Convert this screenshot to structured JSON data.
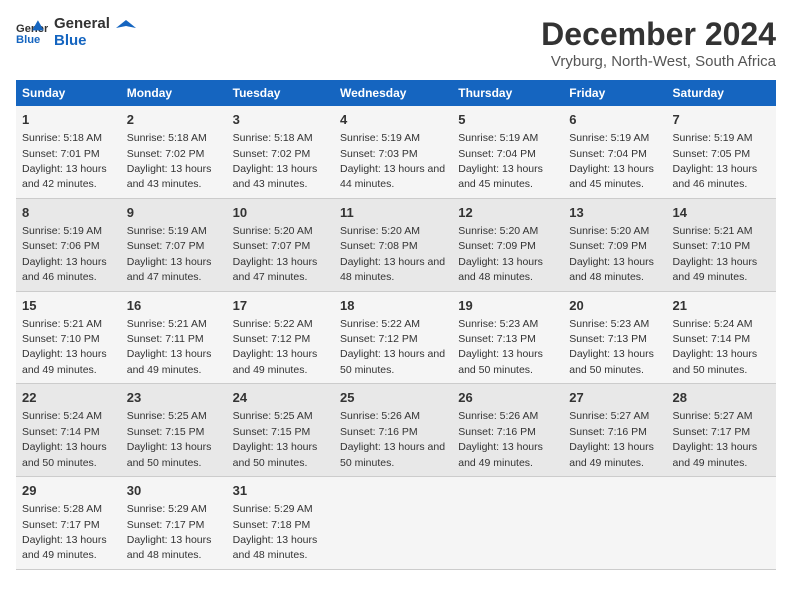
{
  "logo": {
    "line1": "General",
    "line2": "Blue"
  },
  "title": "December 2024",
  "subtitle": "Vryburg, North-West, South Africa",
  "columns": [
    "Sunday",
    "Monday",
    "Tuesday",
    "Wednesday",
    "Thursday",
    "Friday",
    "Saturday"
  ],
  "weeks": [
    [
      {
        "day": "1",
        "sunrise": "5:18 AM",
        "sunset": "7:01 PM",
        "daylight": "13 hours and 42 minutes."
      },
      {
        "day": "2",
        "sunrise": "5:18 AM",
        "sunset": "7:02 PM",
        "daylight": "13 hours and 43 minutes."
      },
      {
        "day": "3",
        "sunrise": "5:18 AM",
        "sunset": "7:02 PM",
        "daylight": "13 hours and 43 minutes."
      },
      {
        "day": "4",
        "sunrise": "5:19 AM",
        "sunset": "7:03 PM",
        "daylight": "13 hours and 44 minutes."
      },
      {
        "day": "5",
        "sunrise": "5:19 AM",
        "sunset": "7:04 PM",
        "daylight": "13 hours and 45 minutes."
      },
      {
        "day": "6",
        "sunrise": "5:19 AM",
        "sunset": "7:04 PM",
        "daylight": "13 hours and 45 minutes."
      },
      {
        "day": "7",
        "sunrise": "5:19 AM",
        "sunset": "7:05 PM",
        "daylight": "13 hours and 46 minutes."
      }
    ],
    [
      {
        "day": "8",
        "sunrise": "5:19 AM",
        "sunset": "7:06 PM",
        "daylight": "13 hours and 46 minutes."
      },
      {
        "day": "9",
        "sunrise": "5:19 AM",
        "sunset": "7:07 PM",
        "daylight": "13 hours and 47 minutes."
      },
      {
        "day": "10",
        "sunrise": "5:20 AM",
        "sunset": "7:07 PM",
        "daylight": "13 hours and 47 minutes."
      },
      {
        "day": "11",
        "sunrise": "5:20 AM",
        "sunset": "7:08 PM",
        "daylight": "13 hours and 48 minutes."
      },
      {
        "day": "12",
        "sunrise": "5:20 AM",
        "sunset": "7:09 PM",
        "daylight": "13 hours and 48 minutes."
      },
      {
        "day": "13",
        "sunrise": "5:20 AM",
        "sunset": "7:09 PM",
        "daylight": "13 hours and 48 minutes."
      },
      {
        "day": "14",
        "sunrise": "5:21 AM",
        "sunset": "7:10 PM",
        "daylight": "13 hours and 49 minutes."
      }
    ],
    [
      {
        "day": "15",
        "sunrise": "5:21 AM",
        "sunset": "7:10 PM",
        "daylight": "13 hours and 49 minutes."
      },
      {
        "day": "16",
        "sunrise": "5:21 AM",
        "sunset": "7:11 PM",
        "daylight": "13 hours and 49 minutes."
      },
      {
        "day": "17",
        "sunrise": "5:22 AM",
        "sunset": "7:12 PM",
        "daylight": "13 hours and 49 minutes."
      },
      {
        "day": "18",
        "sunrise": "5:22 AM",
        "sunset": "7:12 PM",
        "daylight": "13 hours and 50 minutes."
      },
      {
        "day": "19",
        "sunrise": "5:23 AM",
        "sunset": "7:13 PM",
        "daylight": "13 hours and 50 minutes."
      },
      {
        "day": "20",
        "sunrise": "5:23 AM",
        "sunset": "7:13 PM",
        "daylight": "13 hours and 50 minutes."
      },
      {
        "day": "21",
        "sunrise": "5:24 AM",
        "sunset": "7:14 PM",
        "daylight": "13 hours and 50 minutes."
      }
    ],
    [
      {
        "day": "22",
        "sunrise": "5:24 AM",
        "sunset": "7:14 PM",
        "daylight": "13 hours and 50 minutes."
      },
      {
        "day": "23",
        "sunrise": "5:25 AM",
        "sunset": "7:15 PM",
        "daylight": "13 hours and 50 minutes."
      },
      {
        "day": "24",
        "sunrise": "5:25 AM",
        "sunset": "7:15 PM",
        "daylight": "13 hours and 50 minutes."
      },
      {
        "day": "25",
        "sunrise": "5:26 AM",
        "sunset": "7:16 PM",
        "daylight": "13 hours and 50 minutes."
      },
      {
        "day": "26",
        "sunrise": "5:26 AM",
        "sunset": "7:16 PM",
        "daylight": "13 hours and 49 minutes."
      },
      {
        "day": "27",
        "sunrise": "5:27 AM",
        "sunset": "7:16 PM",
        "daylight": "13 hours and 49 minutes."
      },
      {
        "day": "28",
        "sunrise": "5:27 AM",
        "sunset": "7:17 PM",
        "daylight": "13 hours and 49 minutes."
      }
    ],
    [
      {
        "day": "29",
        "sunrise": "5:28 AM",
        "sunset": "7:17 PM",
        "daylight": "13 hours and 49 minutes."
      },
      {
        "day": "30",
        "sunrise": "5:29 AM",
        "sunset": "7:17 PM",
        "daylight": "13 hours and 48 minutes."
      },
      {
        "day": "31",
        "sunrise": "5:29 AM",
        "sunset": "7:18 PM",
        "daylight": "13 hours and 48 minutes."
      },
      {
        "day": "",
        "sunrise": "",
        "sunset": "",
        "daylight": ""
      },
      {
        "day": "",
        "sunrise": "",
        "sunset": "",
        "daylight": ""
      },
      {
        "day": "",
        "sunrise": "",
        "sunset": "",
        "daylight": ""
      },
      {
        "day": "",
        "sunrise": "",
        "sunset": "",
        "daylight": ""
      }
    ]
  ],
  "labels": {
    "sunrise": "Sunrise:",
    "sunset": "Sunset:",
    "daylight": "Daylight:"
  }
}
